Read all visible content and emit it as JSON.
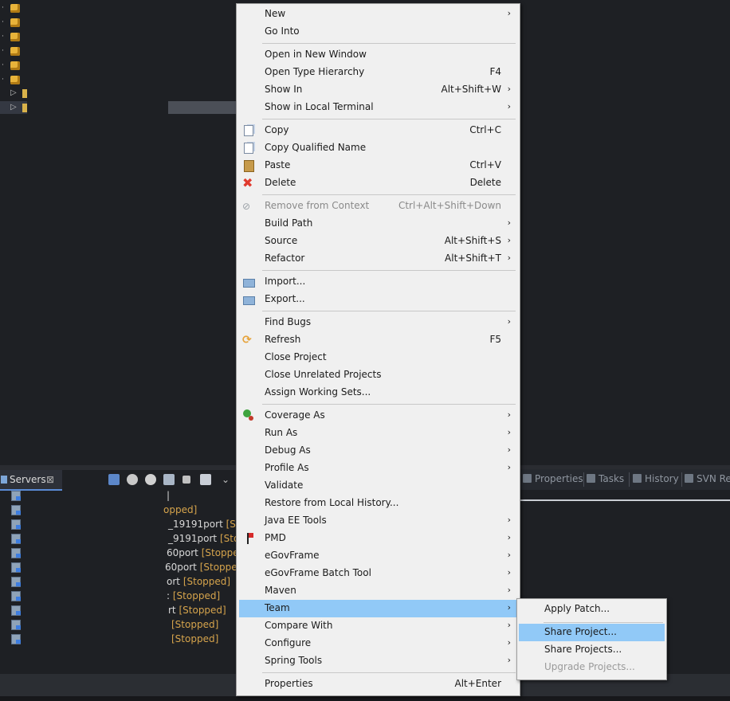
{
  "servers_view": {
    "tab_label": "Servers",
    "close_glyph": "⊠",
    "rows": [
      {
        "name": "|",
        "status": ""
      },
      {
        "name": "",
        "status": "opped]"
      },
      {
        "name": "_19191port",
        "status": "[Sto"
      },
      {
        "name": "_9191port",
        "status": "[Sto"
      },
      {
        "name": "60port",
        "status": "[Stoppe"
      },
      {
        "name": "60port",
        "status": "[Stopped"
      },
      {
        "name": "ort",
        "status": "[Stopped]"
      },
      {
        "name": ":",
        "status": "[Stopped]"
      },
      {
        "name": "rt",
        "status": "[Stopped]"
      },
      {
        "name": "",
        "status": "[Stopped]"
      },
      {
        "name": "",
        "status": "[Stopped]"
      }
    ]
  },
  "right_tabs": {
    "properties": "Properties",
    "tasks": "Tasks",
    "history": "History",
    "svn": "SVN Re"
  },
  "context_menu": {
    "items": [
      {
        "label": "New",
        "shortcut": "",
        "arrow": "›"
      },
      {
        "label": "Go Into",
        "shortcut": "",
        "arrow": ""
      },
      {
        "label": "Open in New Window",
        "shortcut": "",
        "arrow": ""
      },
      {
        "label": "Open Type Hierarchy",
        "shortcut": "F4",
        "arrow": ""
      },
      {
        "label": "Show In",
        "shortcut": "Alt+Shift+W",
        "arrow": "›"
      },
      {
        "label": "Show in Local Terminal",
        "shortcut": "",
        "arrow": "›"
      },
      {
        "label": "Copy",
        "shortcut": "Ctrl+C",
        "arrow": ""
      },
      {
        "label": "Copy Qualified Name",
        "shortcut": "",
        "arrow": ""
      },
      {
        "label": "Paste",
        "shortcut": "Ctrl+V",
        "arrow": ""
      },
      {
        "label": "Delete",
        "shortcut": "Delete",
        "arrow": ""
      },
      {
        "label": "Remove from Context",
        "shortcut": "Ctrl+Alt+Shift+Down",
        "arrow": ""
      },
      {
        "label": "Build Path",
        "shortcut": "",
        "arrow": "›"
      },
      {
        "label": "Source",
        "shortcut": "Alt+Shift+S",
        "arrow": "›"
      },
      {
        "label": "Refactor",
        "shortcut": "Alt+Shift+T",
        "arrow": "›"
      },
      {
        "label": "Import...",
        "shortcut": "",
        "arrow": ""
      },
      {
        "label": "Export...",
        "shortcut": "",
        "arrow": ""
      },
      {
        "label": "Find Bugs",
        "shortcut": "",
        "arrow": "›"
      },
      {
        "label": "Refresh",
        "shortcut": "F5",
        "arrow": ""
      },
      {
        "label": "Close Project",
        "shortcut": "",
        "arrow": ""
      },
      {
        "label": "Close Unrelated Projects",
        "shortcut": "",
        "arrow": ""
      },
      {
        "label": "Assign Working Sets...",
        "shortcut": "",
        "arrow": ""
      },
      {
        "label": "Coverage As",
        "shortcut": "",
        "arrow": "›"
      },
      {
        "label": "Run As",
        "shortcut": "",
        "arrow": "›"
      },
      {
        "label": "Debug As",
        "shortcut": "",
        "arrow": "›"
      },
      {
        "label": "Profile As",
        "shortcut": "",
        "arrow": "›"
      },
      {
        "label": "Validate",
        "shortcut": "",
        "arrow": ""
      },
      {
        "label": "Restore from Local History...",
        "shortcut": "",
        "arrow": ""
      },
      {
        "label": "Java EE Tools",
        "shortcut": "",
        "arrow": "›"
      },
      {
        "label": "PMD",
        "shortcut": "",
        "arrow": "›"
      },
      {
        "label": "eGovFrame",
        "shortcut": "",
        "arrow": "›"
      },
      {
        "label": "eGovFrame Batch Tool",
        "shortcut": "",
        "arrow": "›"
      },
      {
        "label": "Maven",
        "shortcut": "",
        "arrow": "›"
      },
      {
        "label": "Team",
        "shortcut": "",
        "arrow": "›"
      },
      {
        "label": "Compare With",
        "shortcut": "",
        "arrow": "›"
      },
      {
        "label": "Configure",
        "shortcut": "",
        "arrow": "›"
      },
      {
        "label": "Spring Tools",
        "shortcut": "",
        "arrow": "›"
      },
      {
        "label": "Properties",
        "shortcut": "Alt+Enter",
        "arrow": ""
      }
    ]
  },
  "team_submenu": {
    "items": [
      {
        "label": "Apply Patch..."
      },
      {
        "label": "Share Project..."
      },
      {
        "label": "Share Projects..."
      },
      {
        "label": "Upgrade Projects..."
      }
    ]
  }
}
